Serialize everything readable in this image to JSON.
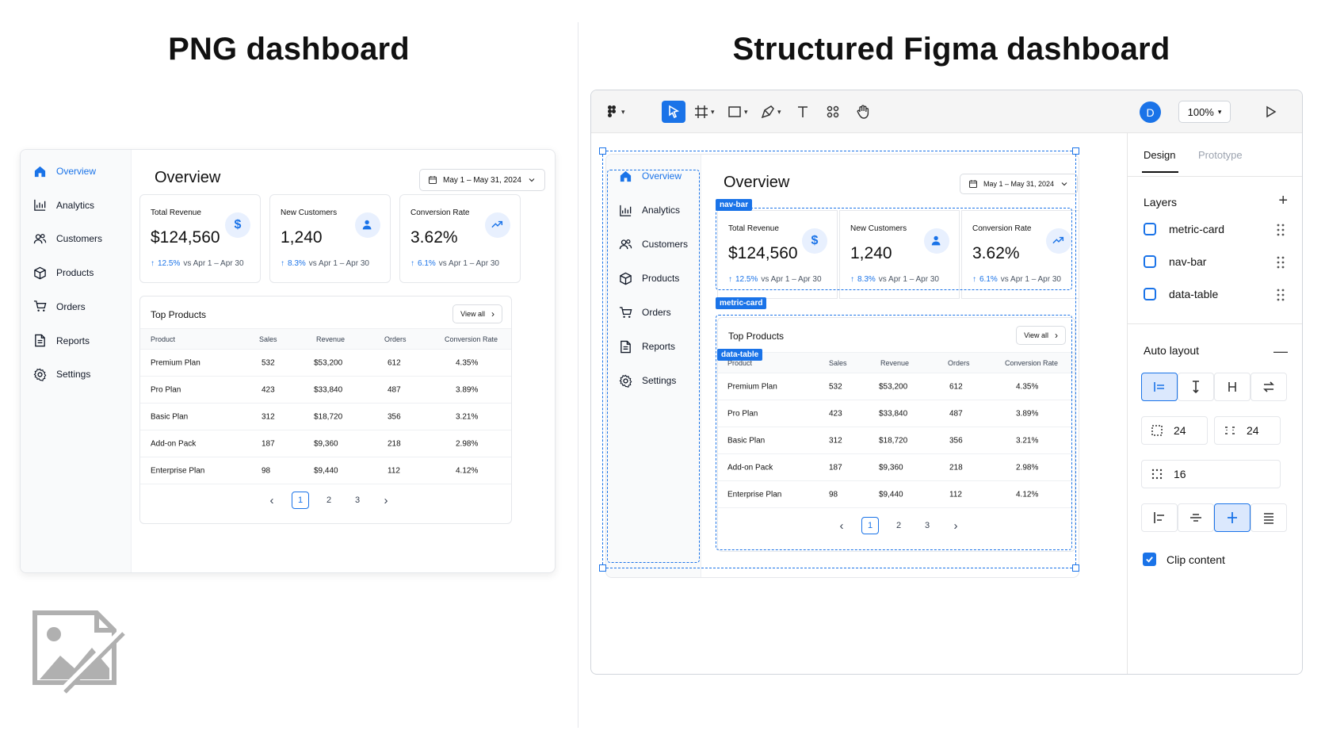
{
  "headings": {
    "left": "PNG dashboard",
    "right": "Structured Figma dashboard"
  },
  "dashboard": {
    "nav": [
      {
        "label": "Overview",
        "icon": "home-icon",
        "active": true
      },
      {
        "label": "Analytics",
        "icon": "bar-chart-icon",
        "active": false
      },
      {
        "label": "Customers",
        "icon": "users-icon",
        "active": false
      },
      {
        "label": "Products",
        "icon": "box-icon",
        "active": false
      },
      {
        "label": "Orders",
        "icon": "cart-icon",
        "active": false
      },
      {
        "label": "Reports",
        "icon": "document-icon",
        "active": false
      },
      {
        "label": "Settings",
        "icon": "gear-icon",
        "active": false
      }
    ],
    "title": "Overview",
    "date_range": "May 1 – May 31, 2024",
    "metrics": [
      {
        "label": "Total Revenue",
        "value": "$124,560",
        "delta": "12.5%",
        "compare": "vs Apr 1 – Apr 30",
        "icon": "dollar-icon"
      },
      {
        "label": "New Customers",
        "value": "1,240",
        "delta": "8.3%",
        "compare": "vs Apr 1 – Apr 30",
        "icon": "user-icon"
      },
      {
        "label": "Conversion Rate",
        "value": "3.62%",
        "delta": "6.1%",
        "compare": "vs Apr 1 – Apr 30",
        "icon": "trend-up-icon"
      }
    ],
    "table": {
      "title": "Top Products",
      "view_all": "View all",
      "columns": [
        "Product",
        "Sales",
        "Revenue",
        "Orders",
        "Conversion Rate"
      ],
      "rows": [
        [
          "Premium Plan",
          "532",
          "$53,200",
          "612",
          "4.35%"
        ],
        [
          "Pro Plan",
          "423",
          "$33,840",
          "487",
          "3.89%"
        ],
        [
          "Basic Plan",
          "312",
          "$18,720",
          "356",
          "3.21%"
        ],
        [
          "Add-on Pack",
          "187",
          "$9,360",
          "218",
          "2.98%"
        ],
        [
          "Enterprise Plan",
          "98",
          "$9,440",
          "112",
          "4.12%"
        ]
      ],
      "pages": [
        "1",
        "2",
        "3"
      ],
      "current_page": "1"
    }
  },
  "figma": {
    "avatar_initial": "D",
    "zoom": "100%",
    "tags": {
      "nav": "nav-bar",
      "metric": "metric-card",
      "table": "data-table"
    },
    "panel": {
      "tabs": [
        "Design",
        "Prototype"
      ],
      "active_tab": "Design",
      "layers_title": "Layers",
      "layers": [
        "metric-card",
        "nav-bar",
        "data-table"
      ],
      "auto_layout_title": "Auto layout",
      "padding_h": "24",
      "padding_v": "24",
      "gap": "16",
      "clip_content": "Clip content",
      "clip_checked": true
    }
  },
  "colors": {
    "accent": "#1a73e8",
    "text": "#111827",
    "muted": "#4b5563"
  }
}
